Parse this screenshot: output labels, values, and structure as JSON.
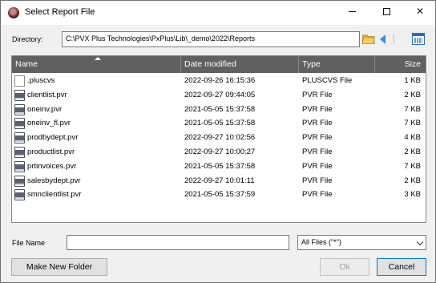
{
  "window": {
    "title": "Select Report File"
  },
  "directory": {
    "label": "Directory:",
    "value": "C:\\PVX Plus Technologies\\PxPlus\\Lib\\_demo\\2022\\Reports"
  },
  "list": {
    "columns": {
      "name": "Name",
      "date": "Date modified",
      "type": "Type",
      "size": "Size"
    },
    "rows": [
      {
        "icon": "document-icon",
        "name": ".pluscvs",
        "date": "2022-09-26 16:15:36",
        "type": "PLUSCVS File",
        "size": "1 KB"
      },
      {
        "icon": "printer-icon",
        "name": "clientlist.pvr",
        "date": "2022-09-27 09:44:05",
        "type": "PVR File",
        "size": "2 KB"
      },
      {
        "icon": "printer-icon",
        "name": "oneinv.pvr",
        "date": "2021-05-05 15:37:58",
        "type": "PVR File",
        "size": "7 KB"
      },
      {
        "icon": "printer-icon",
        "name": "oneinv_fl.pvr",
        "date": "2021-05-05 15:37:58",
        "type": "PVR File",
        "size": "7 KB"
      },
      {
        "icon": "printer-icon",
        "name": "prodbydept.pvr",
        "date": "2022-09-27 10:02:56",
        "type": "PVR File",
        "size": "4 KB"
      },
      {
        "icon": "printer-icon",
        "name": "productlist.pvr",
        "date": "2022-09-27 10:00:27",
        "type": "PVR File",
        "size": "2 KB"
      },
      {
        "icon": "printer-icon",
        "name": "prtinvoices.pvr",
        "date": "2021-05-05 15:37:58",
        "type": "PVR File",
        "size": "7 KB"
      },
      {
        "icon": "printer-icon",
        "name": "salesbydept.pvr",
        "date": "2022-09-27 10:01:11",
        "type": "PVR File",
        "size": "2 KB"
      },
      {
        "icon": "printer-icon",
        "name": "smnclientlist.pvr",
        "date": "2021-05-05 15:37:59",
        "type": "PVR File",
        "size": "3 KB"
      }
    ]
  },
  "file_name": {
    "label": "File Name",
    "value": ""
  },
  "filter": {
    "selected": "All Files (\"*\")"
  },
  "buttons": {
    "make_new_folder": "Make New Folder",
    "ok": "Ok",
    "cancel": "Cancel"
  },
  "colors": {
    "header_bg": "#606060",
    "accent": "#0078d7"
  }
}
